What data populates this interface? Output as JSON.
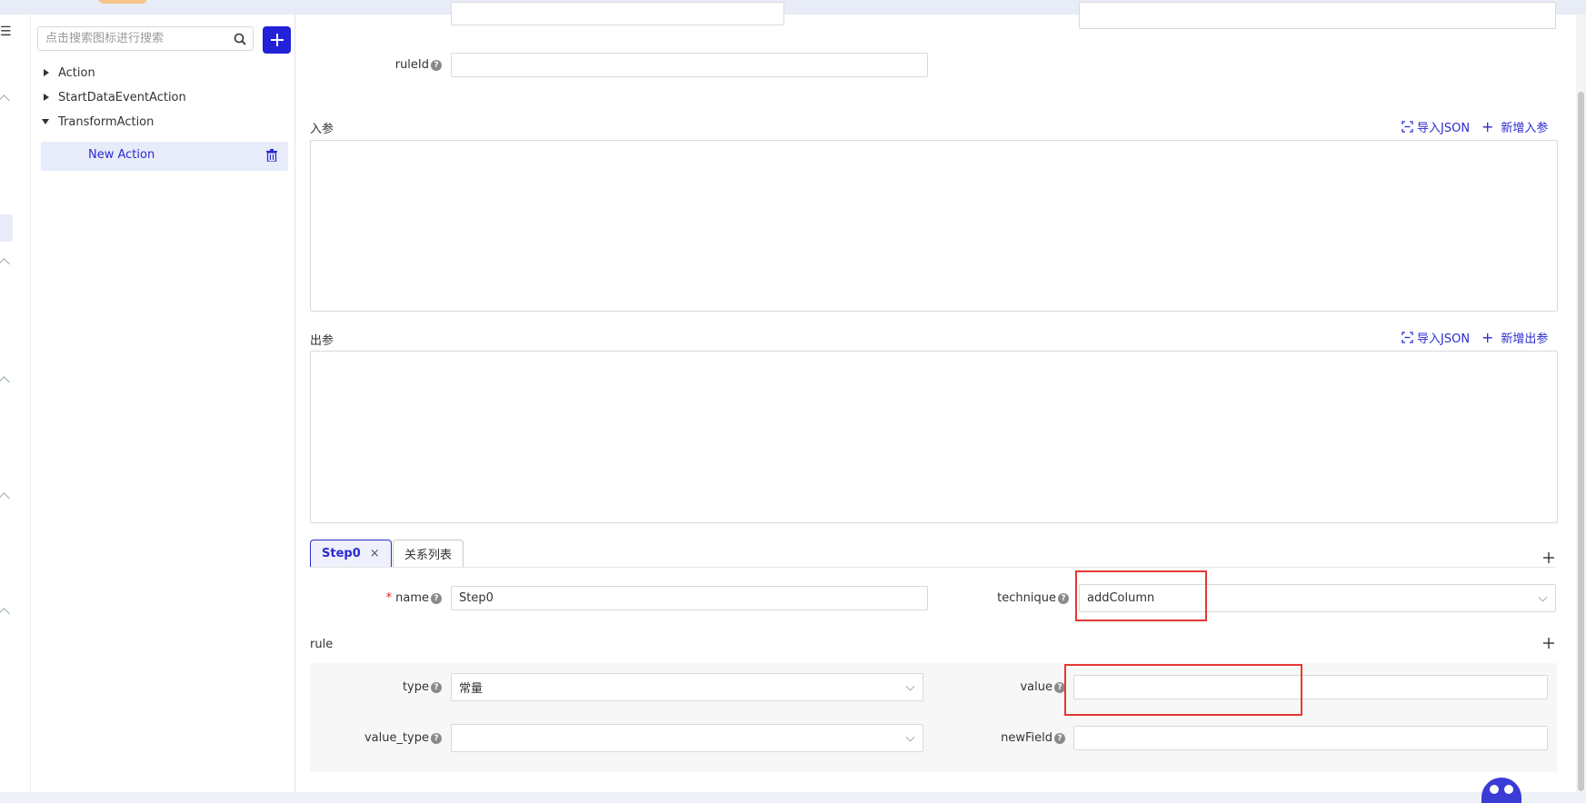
{
  "sidebar": {
    "search_placeholder": "点击搜索图标进行搜索",
    "tree": [
      {
        "label": "Action",
        "expanded": false
      },
      {
        "label": "StartDataEventAction",
        "expanded": false
      },
      {
        "label": "TransformAction",
        "expanded": true
      }
    ],
    "selected_child": "New Action"
  },
  "form": {
    "ruleId_label": "ruleId",
    "ruleId_value": "",
    "input_params_title": "入参",
    "output_params_title": "出参",
    "import_json_label": "导入JSON",
    "add_input_label": "新增入参",
    "add_output_label": "新增出参"
  },
  "tabs": [
    {
      "label": "Step0",
      "active": true,
      "close": "×"
    },
    {
      "label": "关系列表",
      "active": false
    }
  ],
  "step": {
    "name_label": "name",
    "name_value": "Step0",
    "technique_label": "technique",
    "technique_value": "addColumn",
    "rule_title": "rule",
    "type_label": "type",
    "type_value": "常量",
    "value_label": "value",
    "value_value": "",
    "value_type_label": "value_type",
    "value_type_value": "",
    "newField_label": "newField",
    "newField_value": ""
  },
  "colors": {
    "accent": "#2222d8",
    "link": "#2b2bd0",
    "highlight_box": "#e53935"
  }
}
